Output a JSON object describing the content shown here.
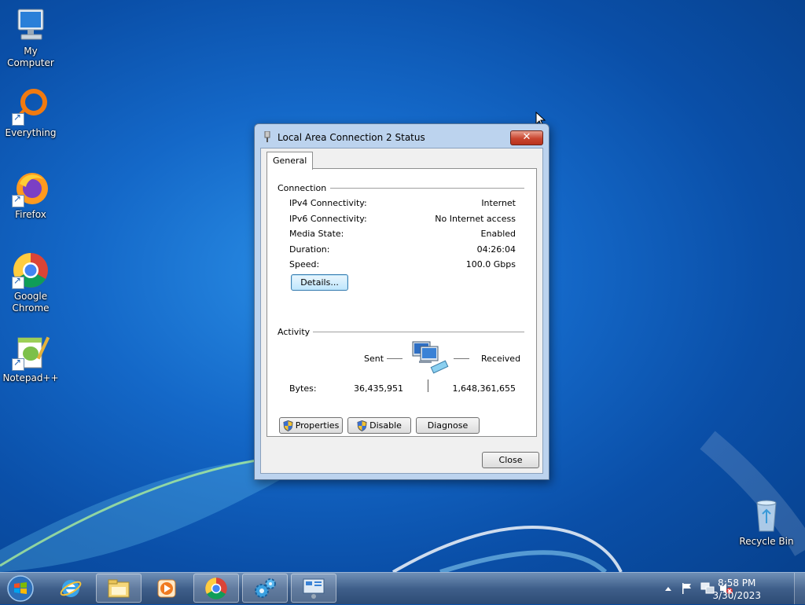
{
  "desktop": {
    "icons": [
      {
        "label": "My Computer"
      },
      {
        "label": "Everything"
      },
      {
        "label": "Firefox"
      },
      {
        "label": "Google Chrome"
      },
      {
        "label": "Notepad++"
      },
      {
        "label": "Recycle Bin"
      }
    ]
  },
  "dialog": {
    "title": "Local Area Connection 2 Status",
    "close_label": "✕",
    "tab_label": "General",
    "connection": {
      "group_title": "Connection",
      "rows": [
        {
          "label": "IPv4 Connectivity:",
          "value": "Internet"
        },
        {
          "label": "IPv6 Connectivity:",
          "value": "No Internet access"
        },
        {
          "label": "Media State:",
          "value": "Enabled"
        },
        {
          "label": "Duration:",
          "value": "04:26:04"
        },
        {
          "label": "Speed:",
          "value": "100.0 Gbps"
        }
      ],
      "details_button": "Details..."
    },
    "activity": {
      "group_title": "Activity",
      "sent_label": "Sent",
      "received_label": "Received",
      "bytes_label": "Bytes:",
      "sent_bytes": "36,435,951",
      "received_bytes": "1,648,361,655"
    },
    "buttons": {
      "properties": "Properties",
      "disable": "Disable",
      "diagnose": "Diagnose",
      "close": "Close"
    }
  },
  "taskbar": {
    "items": [
      {
        "icon": "internet-explorer-icon"
      },
      {
        "icon": "file-explorer-icon"
      },
      {
        "icon": "media-player-icon"
      },
      {
        "icon": "chrome-icon"
      },
      {
        "icon": "control-panel-gears-icon"
      },
      {
        "icon": "network-remote-icon"
      }
    ],
    "clock": {
      "time": "8:58 PM",
      "date": "3/30/2023"
    }
  }
}
